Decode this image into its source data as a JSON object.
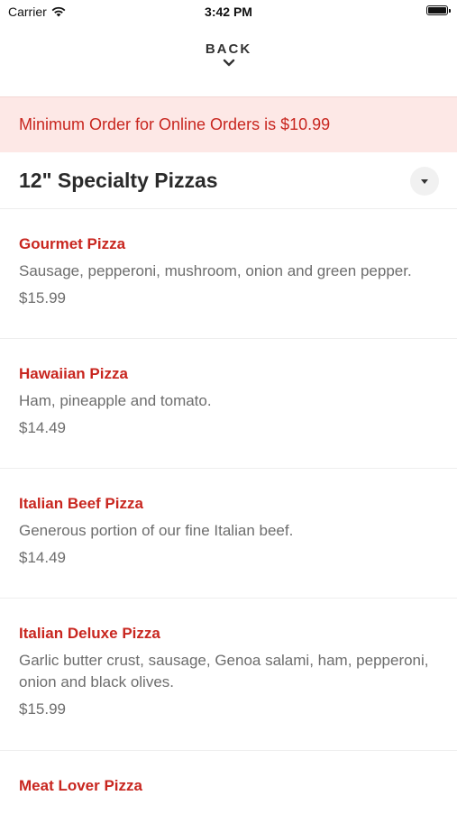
{
  "status_bar": {
    "carrier": "Carrier",
    "time": "3:42 PM"
  },
  "nav": {
    "back_label": "BACK"
  },
  "notice": {
    "text": "Minimum Order for Online Orders is $10.99"
  },
  "section": {
    "title": "12\" Specialty Pizzas"
  },
  "items": [
    {
      "name": "Gourmet Pizza",
      "description": "Sausage, pepperoni, mushroom, onion and green pepper.",
      "price": "$15.99"
    },
    {
      "name": "Hawaiian Pizza",
      "description": "Ham, pineapple and tomato.",
      "price": "$14.49"
    },
    {
      "name": "Italian Beef Pizza",
      "description": "Generous portion of our fine Italian beef.",
      "price": "$14.49"
    },
    {
      "name": "Italian Deluxe Pizza",
      "description": "Garlic butter crust, sausage, Genoa salami, ham, pepperoni, onion and black olives.",
      "price": "$15.99"
    },
    {
      "name": "Meat Lover Pizza",
      "description": "",
      "price": ""
    }
  ],
  "colors": {
    "accent": "#c8261f",
    "notice_bg": "#fde8e6"
  }
}
